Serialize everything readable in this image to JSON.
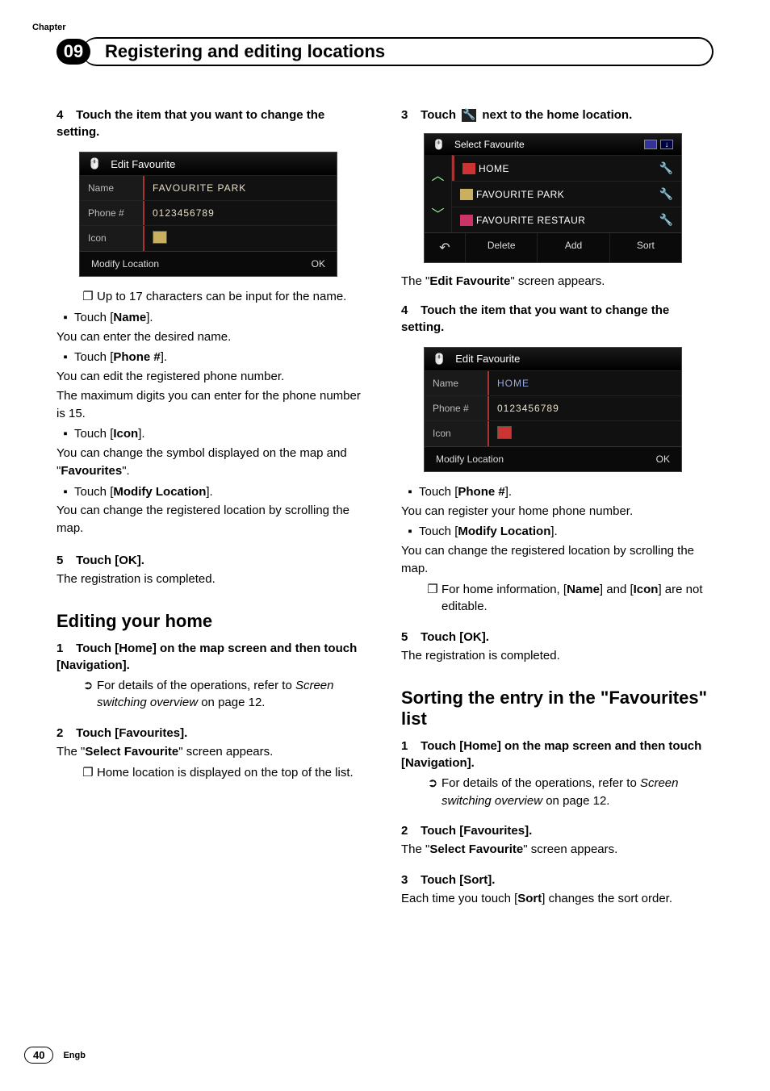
{
  "header": {
    "chapter_label": "Chapter",
    "chapter_number": "09",
    "chapter_title": "Registering and editing locations"
  },
  "left": {
    "step4": "Touch the item that you want to change the setting.",
    "shot1": {
      "title": "Edit Favourite",
      "name_lbl": "Name",
      "name_val": "FAVOURITE PARK",
      "phone_lbl": "Phone #",
      "phone_val": "0123456789",
      "icon_lbl": "Icon",
      "modify": "Modify Location",
      "ok": "OK"
    },
    "note1": "Up to 17 characters can be input for the name.",
    "b1_pre": "Touch [",
    "b1_bold": "Name",
    "b1_post": "].",
    "b1_body": "You can enter the desired name.",
    "b2_pre": "Touch [",
    "b2_bold": "Phone #",
    "b2_post": "].",
    "b2_body1": "You can edit the registered phone number.",
    "b2_body2": "The maximum digits you can enter for the phone number is 15.",
    "b3_pre": "Touch [",
    "b3_bold": "Icon",
    "b3_post": "].",
    "b3_body_a": "You can change the symbol displayed on the map and \"",
    "b3_body_bold": "Favourites",
    "b3_body_b": "\".",
    "b4_pre": "Touch [",
    "b4_bold": "Modify Location",
    "b4_post": "].",
    "b4_body": "You can change the registered location by scrolling the map.",
    "step5": "Touch [OK].",
    "step5_body": "The registration is completed.",
    "section1": "Editing your home",
    "eh_step1": "Touch [Home] on the map screen and then touch [Navigation].",
    "eh_refer_a": "For details of the operations, refer to ",
    "eh_refer_i": "Screen switching overview",
    "eh_refer_b": " on page 12.",
    "eh_step2": "Touch [Favourites].",
    "eh_step2_body_a": "The \"",
    "eh_step2_body_bold": "Select Favourite",
    "eh_step2_body_b": "\" screen appears.",
    "eh_note": "Home location is displayed on the top of the list."
  },
  "right": {
    "step3_a": "Touch ",
    "step3_b": " next to the home location.",
    "shot_fav": {
      "title": "Select Favourite",
      "rows": [
        "HOME",
        "FAVOURITE PARK",
        "FAVOURITE RESTAUR"
      ],
      "delete": "Delete",
      "add": "Add",
      "sort": "Sort"
    },
    "after_fav_a": "The \"",
    "after_fav_bold": "Edit Favourite",
    "after_fav_b": "\" screen appears.",
    "step4": "Touch the item that you want to change the setting.",
    "shot2": {
      "title": "Edit Favourite",
      "name_lbl": "Name",
      "name_val": "HOME",
      "phone_lbl": "Phone #",
      "phone_val": "0123456789",
      "icon_lbl": "Icon",
      "modify": "Modify Location",
      "ok": "OK"
    },
    "rb1_pre": "Touch [",
    "rb1_bold": "Phone #",
    "rb1_post": "].",
    "rb1_body": "You can register your home phone number.",
    "rb2_pre": "Touch [",
    "rb2_bold": "Modify Location",
    "rb2_post": "].",
    "rb2_body": "You can change the registered location by scrolling the map.",
    "rnote_a": "For home information, [",
    "rnote_b1": "Name",
    "rnote_mid": "] and [",
    "rnote_b2": "Icon",
    "rnote_c": "] are not editable.",
    "step5": "Touch [OK].",
    "step5_body": "The registration is completed.",
    "section2_a": "Sorting the entry in the \"",
    "section2_b": "Favourites",
    "section2_c": "\" list",
    "s2_step1": "Touch [Home] on the map screen and then touch [Navigation].",
    "s2_refer_a": "For details of the operations, refer to ",
    "s2_refer_i": "Screen switching overview",
    "s2_refer_b": " on page 12.",
    "s2_step2": "Touch [Favourites].",
    "s2_step2_body_a": "The \"",
    "s2_step2_body_bold": "Select Favourite",
    "s2_step2_body_b": "\" screen appears.",
    "s2_step3": "Touch [Sort].",
    "s2_step3_body_a": "Each time you touch [",
    "s2_step3_body_bold": "Sort",
    "s2_step3_body_b": "] changes the sort order."
  },
  "footer": {
    "page": "40",
    "locale": "Engb"
  }
}
